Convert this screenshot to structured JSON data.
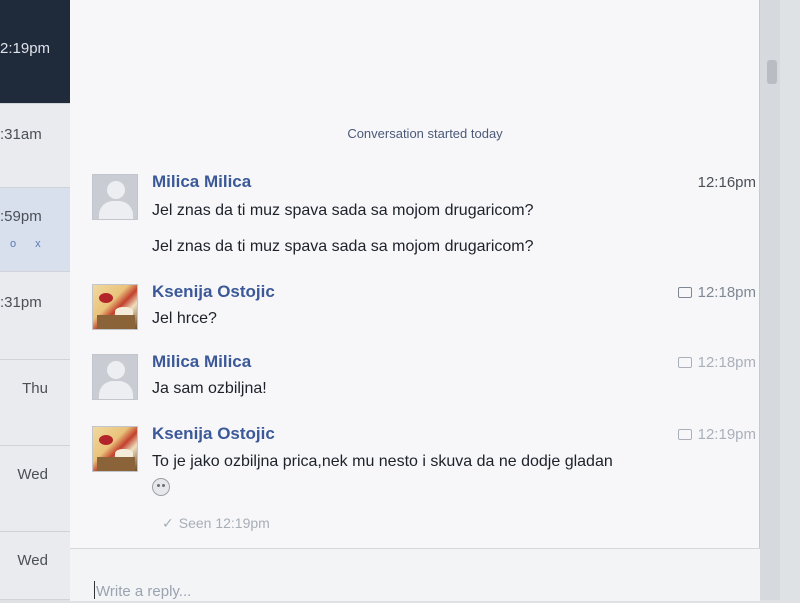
{
  "sidebar": {
    "items": [
      {
        "time": "2:19pm"
      },
      {
        "time": ":31am"
      },
      {
        "time": ":59pm",
        "actions": "o x"
      },
      {
        "time": ":31pm"
      },
      {
        "time": "Thu"
      },
      {
        "time": "Wed"
      },
      {
        "time": "Wed"
      }
    ]
  },
  "conversation": {
    "started_label": "Conversation started today",
    "messages": [
      {
        "sender": "Milica Milica",
        "time": "12:16pm",
        "lines": [
          "Jel znas da ti muz spava sada sa mojom drugaricom?",
          "Jel znas da ti muz spava sada sa mojom drugaricom?"
        ]
      },
      {
        "sender": "Ksenija Ostojic",
        "time": "12:18pm",
        "lines": [
          "Jel hrce?"
        ]
      },
      {
        "sender": "Milica Milica",
        "time": "12:18pm",
        "lines": [
          "Ja sam ozbiljna!"
        ]
      },
      {
        "sender": "Ksenija Ostojic",
        "time": "12:19pm",
        "lines": [
          "To je jako ozbiljna prica,nek mu nesto i skuva da ne dodje gladan"
        ],
        "emoji": "sad-face-icon"
      }
    ],
    "seen": "Seen 12:19pm"
  },
  "composer": {
    "placeholder": "Write a reply..."
  },
  "colors": {
    "sender_name": "#3b5998",
    "text": "#1d2129",
    "meta": "#4b4f56"
  }
}
